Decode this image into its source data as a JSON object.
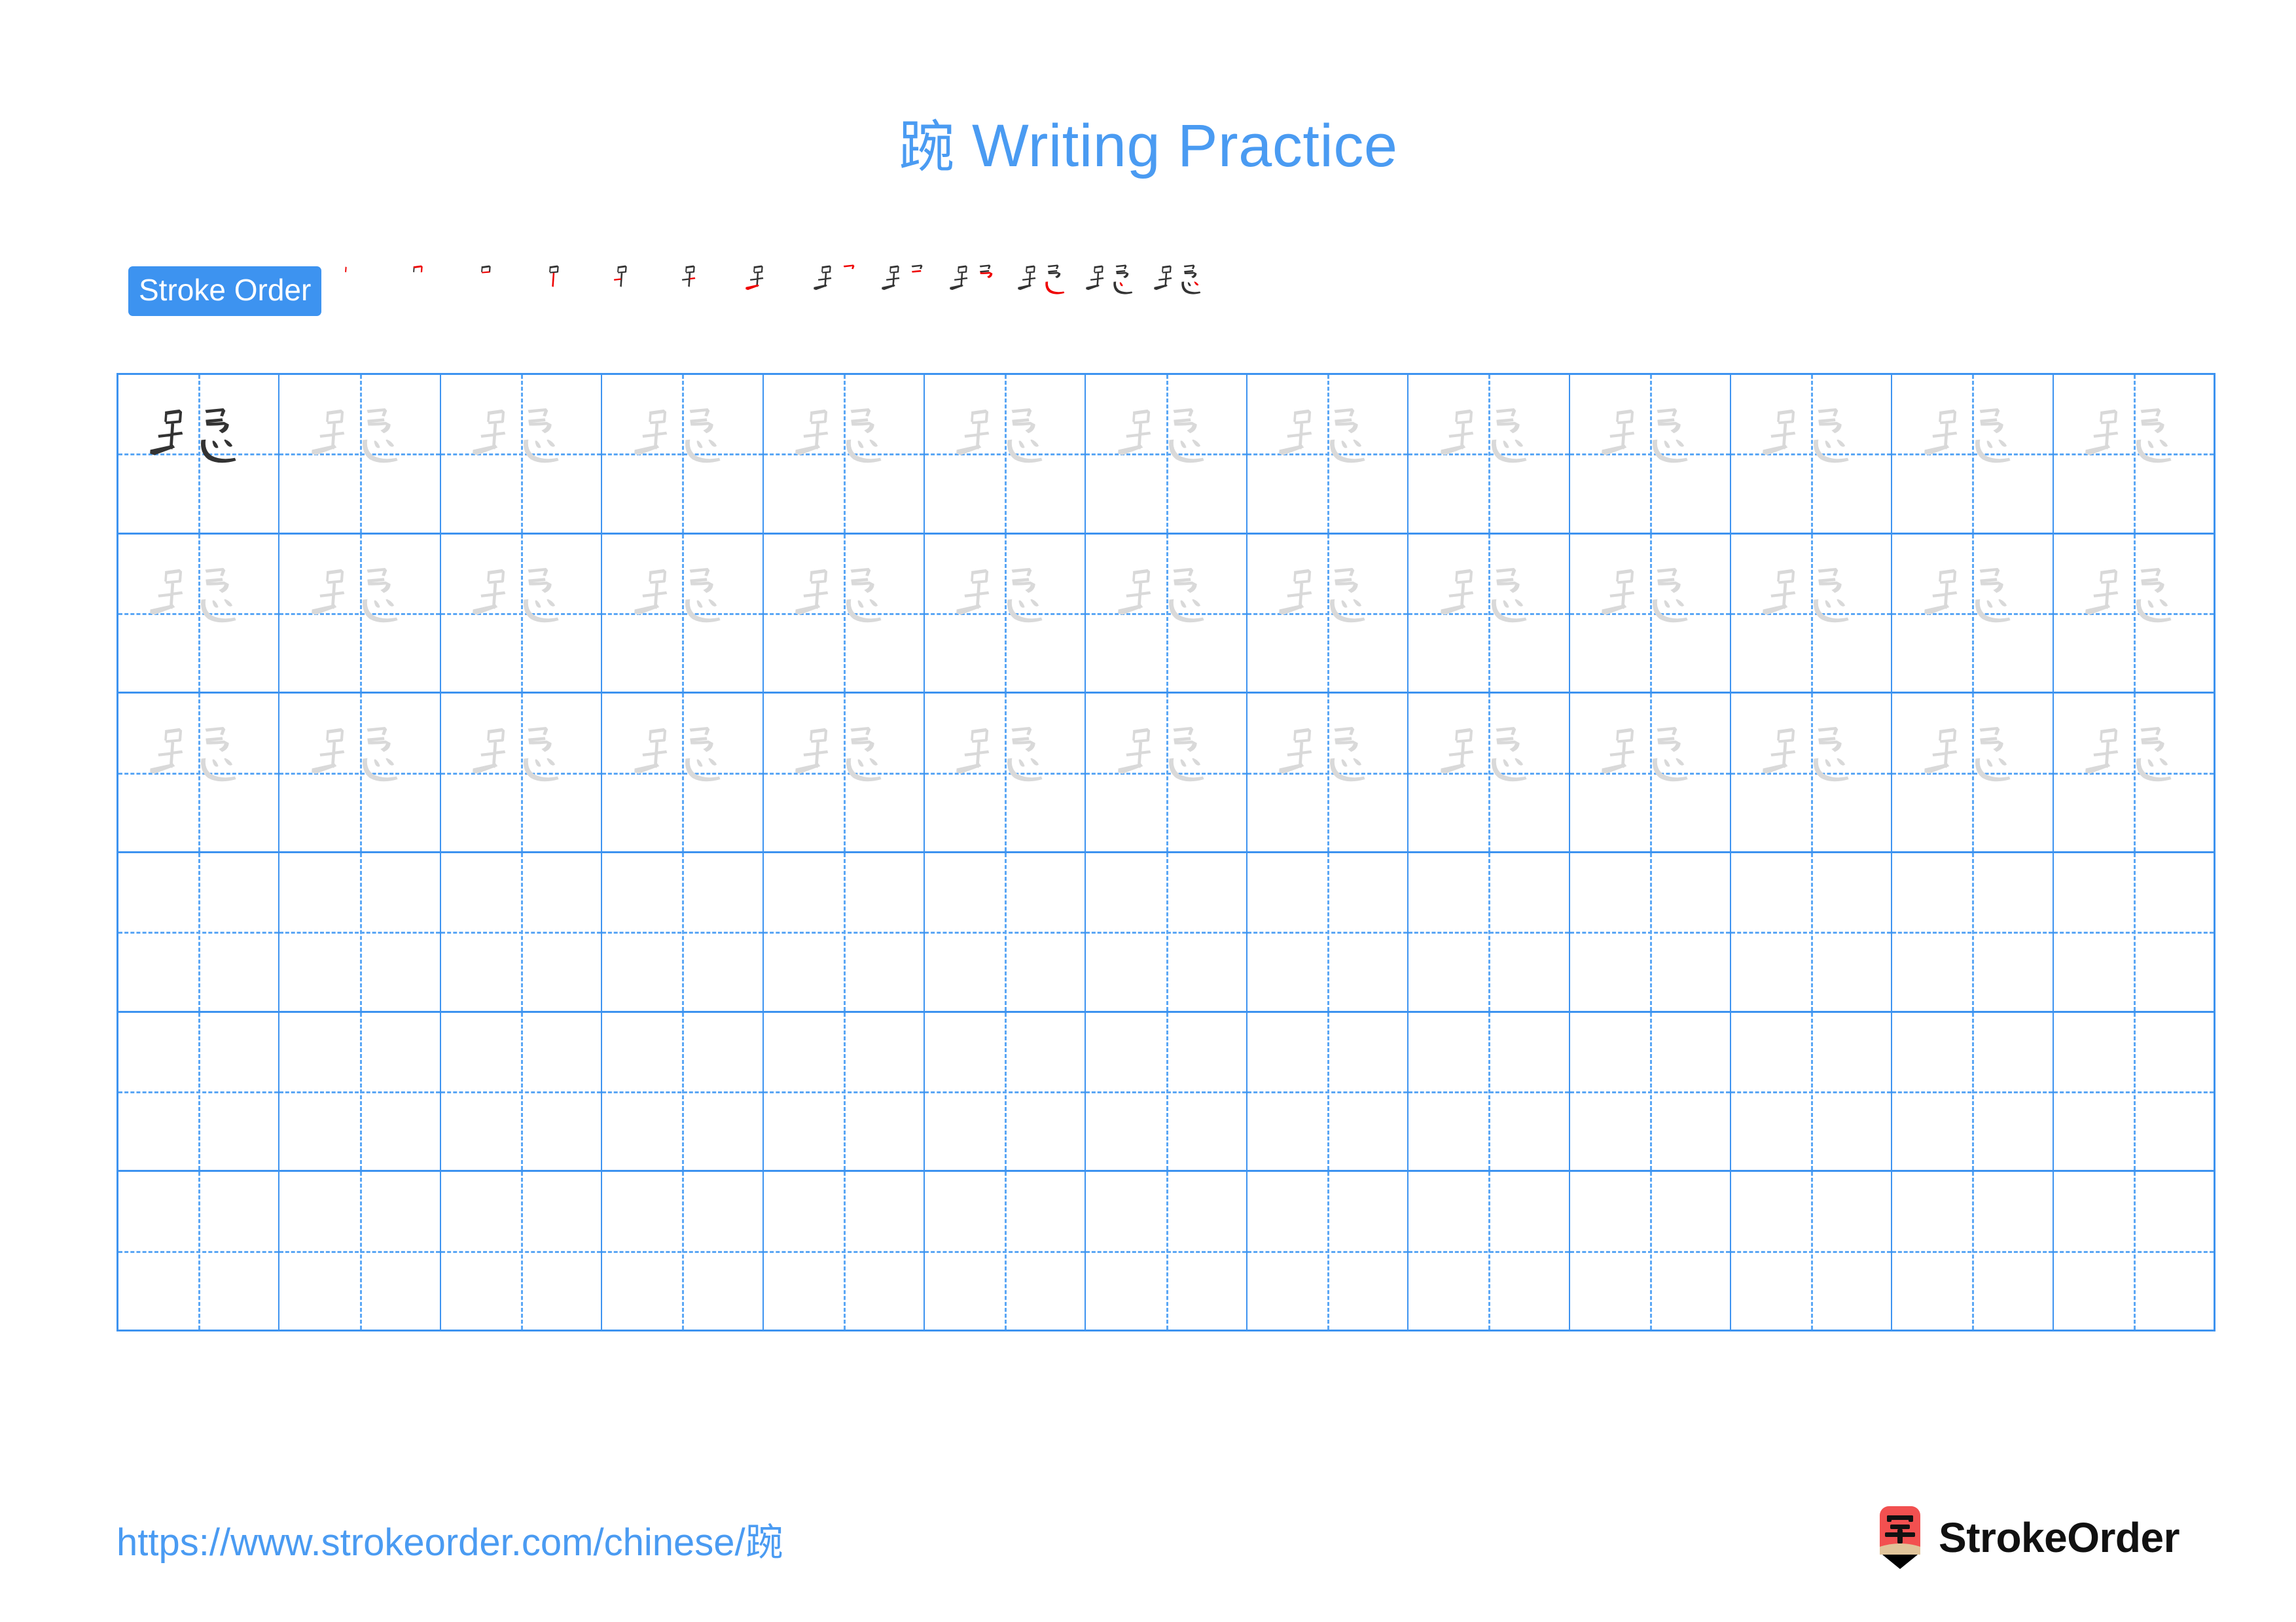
{
  "page": {
    "character": "踠",
    "title_suffix": " Writing Practice",
    "title_full": "踠 Writing Practice",
    "accent_blue": "#4a9bf2",
    "grid_blue": "#3d93f0",
    "guide_blue": "#5ba7f5",
    "stroke_new_color": "#ee0000",
    "stroke_done_color": "#333333",
    "trace_gray": "#d9d9d9",
    "ink_dark": "#333333"
  },
  "stroke_order": {
    "badge_label": "Stroke Order",
    "total_strokes": 13,
    "steps": [
      1,
      2,
      3,
      4,
      5,
      6,
      7,
      8,
      9,
      10,
      11,
      12,
      13
    ]
  },
  "practice_grid": {
    "columns": 13,
    "rows": 6,
    "filled_rows": 3,
    "blank_rows": 3,
    "first_cell_is_dark": true,
    "cell_character": "踠"
  },
  "footer": {
    "url": "https://www.strokeorder.com/chinese/踠",
    "url_prefix": "https://www.strokeorder.com/chinese/",
    "brand_name": "StrokeOrder",
    "logo_character": "字",
    "logo_body_color": "#f25050",
    "logo_wood_color": "#e0c49a",
    "logo_tip_color": "#000000"
  }
}
